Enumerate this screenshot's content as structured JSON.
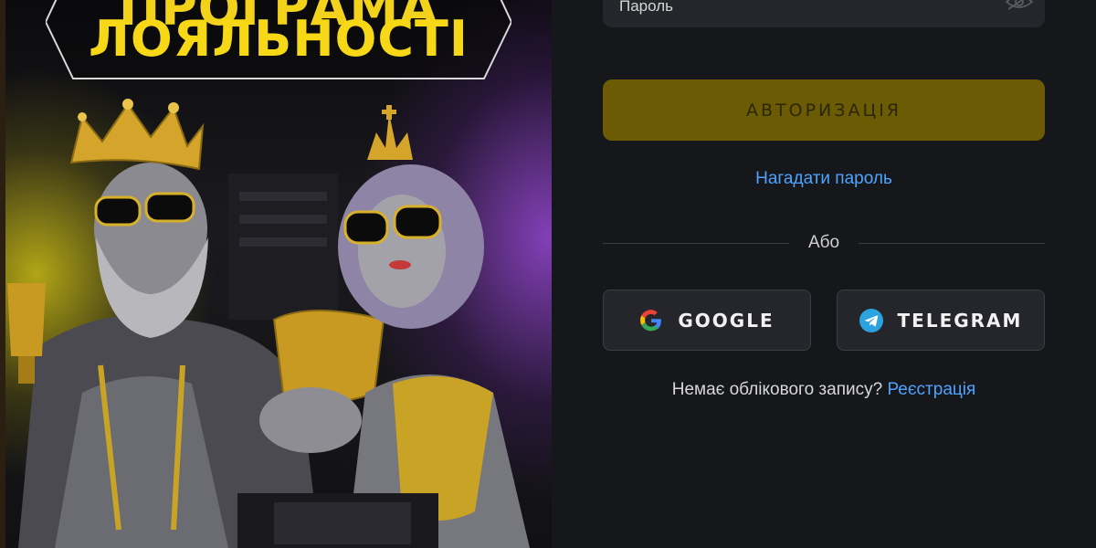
{
  "banner": {
    "title_line1": "ПРОГРАМА",
    "title_line2": "ЛОЯЛЬНОСТІ",
    "accent": "#f7d817"
  },
  "form": {
    "password_placeholder": "Пароль",
    "password_toggle_icon": "eye-slash-icon",
    "submit_label": "АВТОРИЗАЦІЯ",
    "forgot_label": "Нагадати пароль",
    "divider_label": "Або",
    "social": {
      "google_label": "GOOGLE",
      "google_icon": "google-icon",
      "telegram_label": "TELEGRAM",
      "telegram_icon": "telegram-icon"
    },
    "signup_prompt": "Немає облікового запису?",
    "signup_link": "Реєстрація"
  },
  "colors": {
    "background": "#16171b",
    "field": "#25262b",
    "submit": "#6b5b05",
    "link": "#4ea3ff"
  }
}
